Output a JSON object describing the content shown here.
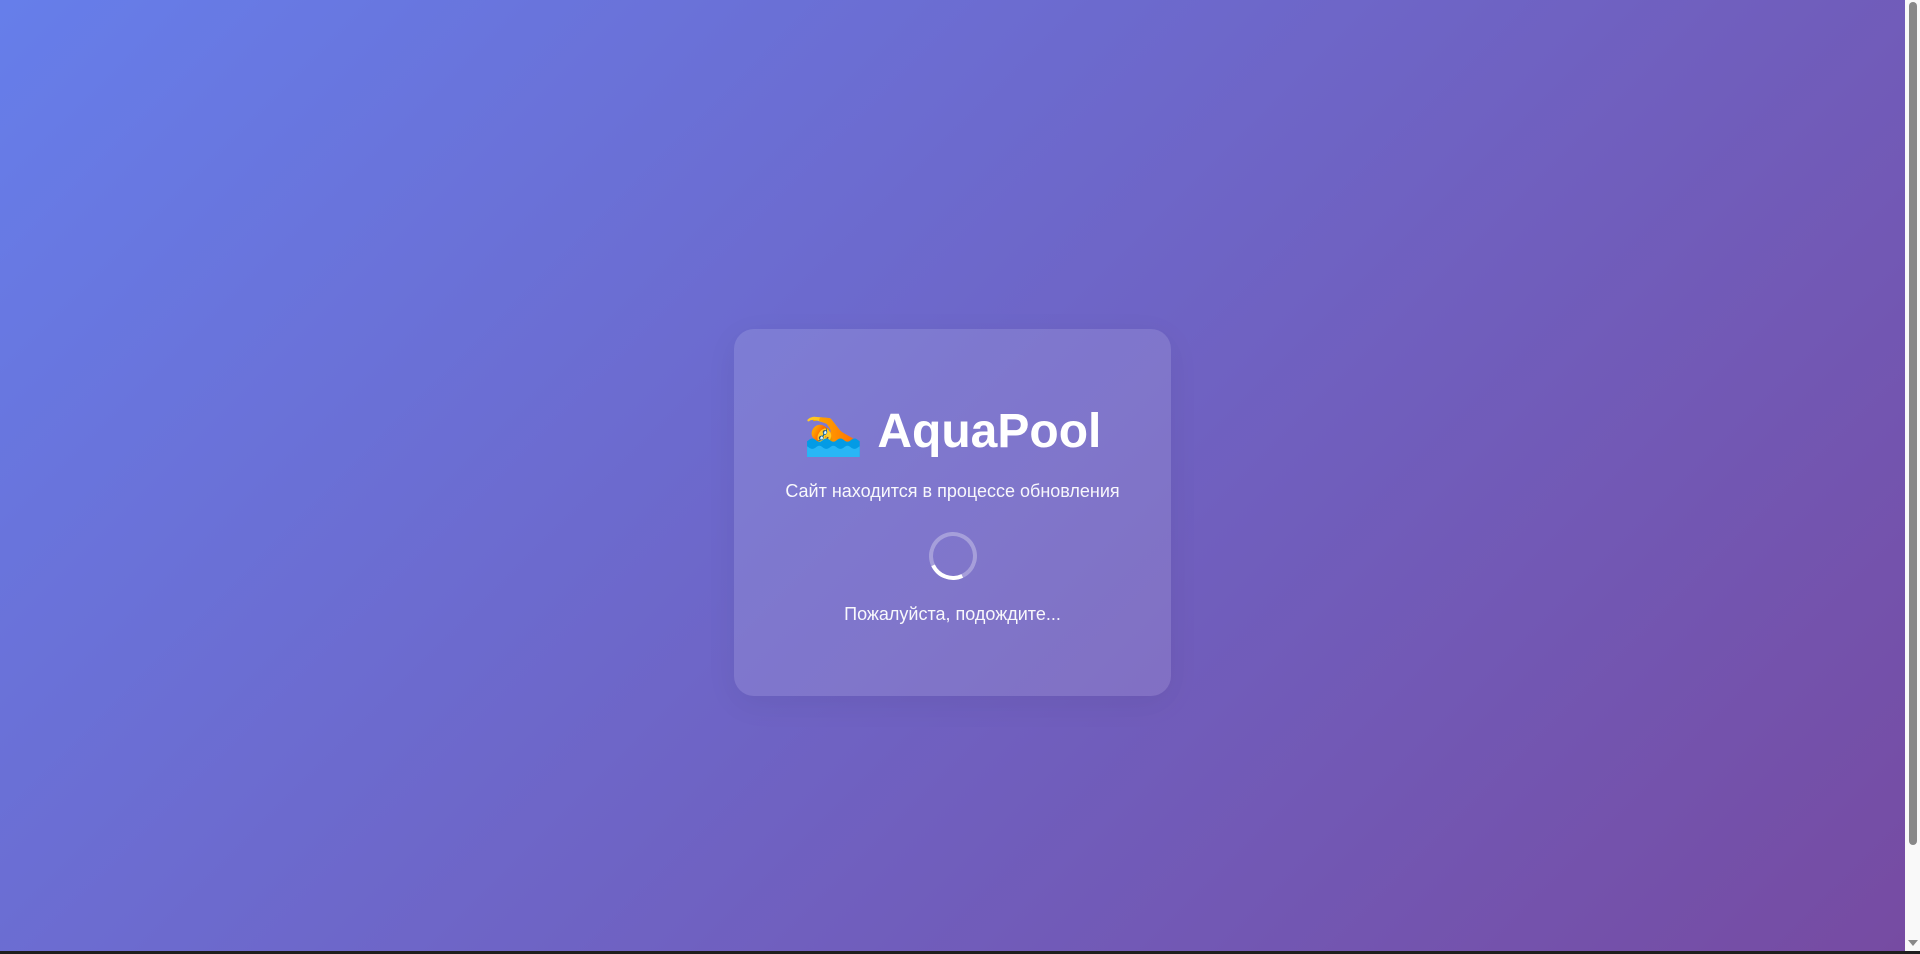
{
  "brand": {
    "icon": "swimmer-emoji",
    "emoji": "🏊",
    "name": "AquaPool"
  },
  "subtitle": "Сайт находится в процессе обновления",
  "wait_text": "Пожалуйста, подождите...",
  "colors": {
    "gradient_start": "#667eea",
    "gradient_end": "#764ba2"
  }
}
